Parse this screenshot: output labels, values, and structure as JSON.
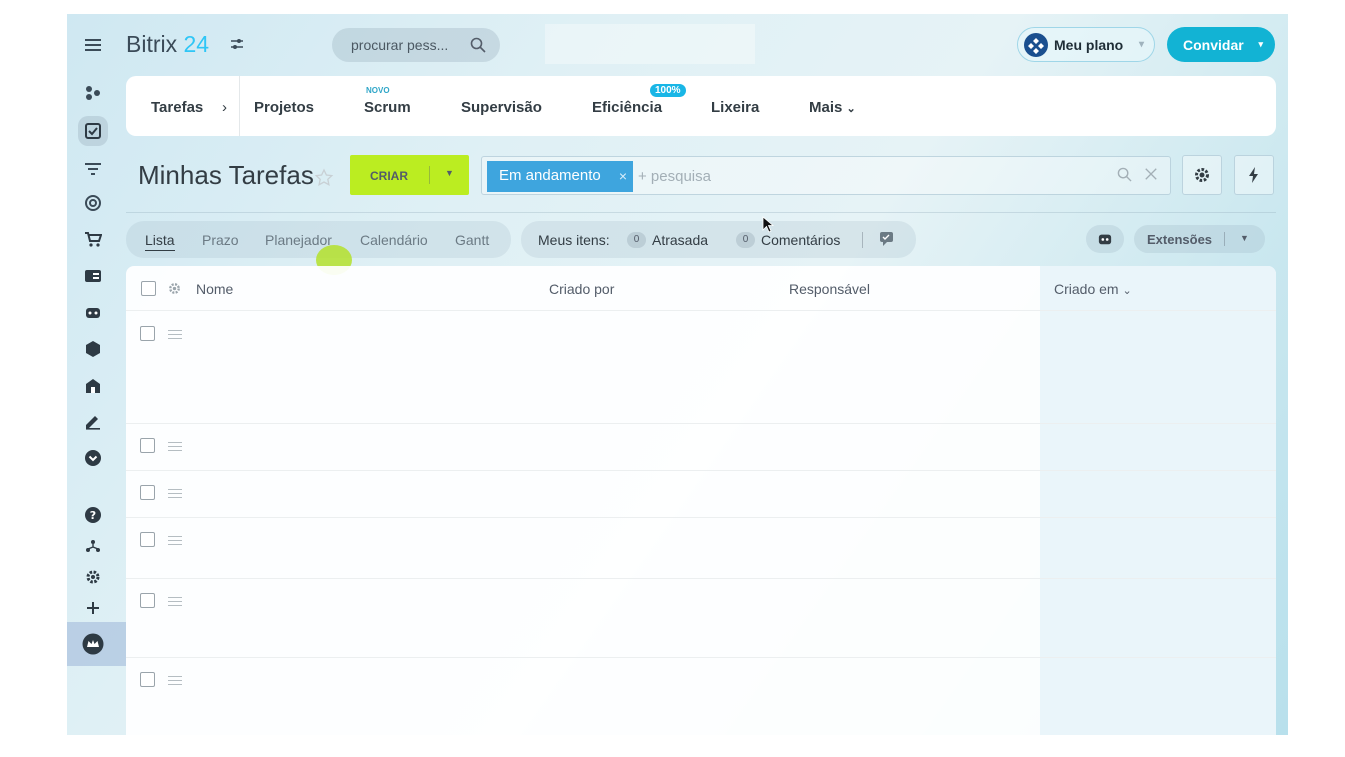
{
  "app": {
    "logo_name": "Bitrix",
    "logo_num": "24"
  },
  "header": {
    "search_placeholder": "procurar pess...",
    "plan_label": "Meu plano",
    "invite_label": "Convidar"
  },
  "nav": {
    "tarefas": "Tarefas",
    "arrow": "›",
    "projetos": "Projetos",
    "scrum_tag": "NOVO",
    "scrum": "Scrum",
    "supervisao": "Supervisão",
    "eficiencia_badge": "100%",
    "eficiencia": "Eficiência",
    "lixeira": "Lixeira",
    "mais": "Mais"
  },
  "page": {
    "title": "Minhas Tarefas",
    "create_label": "CRIAR",
    "filter_chip": "Em andamento",
    "filter_placeholder": "+ pesquisa"
  },
  "views": {
    "lista": "Lista",
    "prazo": "Prazo",
    "planejador": "Planejador",
    "calendario": "Calendário",
    "gantt": "Gantt"
  },
  "counters": {
    "label": "Meus itens:",
    "overdue_count": "0",
    "overdue_label": "Atrasada",
    "comments_count": "0",
    "comments_label": "Comentários"
  },
  "extensions_label": "Extensões",
  "table": {
    "columns": {
      "nome": "Nome",
      "criado_por": "Criado por",
      "responsavel": "Responsável",
      "criado_em": "Criado em"
    },
    "rows": [
      {},
      {},
      {},
      {},
      {},
      {}
    ]
  },
  "colors": {
    "accent": "#2fc6f6",
    "create_button": "#bbed21",
    "invite_button": "#12b3d4",
    "filter_chip": "#3ea5de"
  },
  "icons": {
    "menu": "hamburger-icon",
    "rail": [
      "share-icon",
      "tasks-icon",
      "filter-icon",
      "target-icon",
      "cart-icon",
      "contact-card-icon",
      "robot-icon",
      "box-icon",
      "building-icon",
      "signature-icon",
      "chevron-circle-icon",
      "help-icon",
      "org-icon",
      "gear-icon",
      "plus-icon",
      "crown-icon"
    ]
  }
}
